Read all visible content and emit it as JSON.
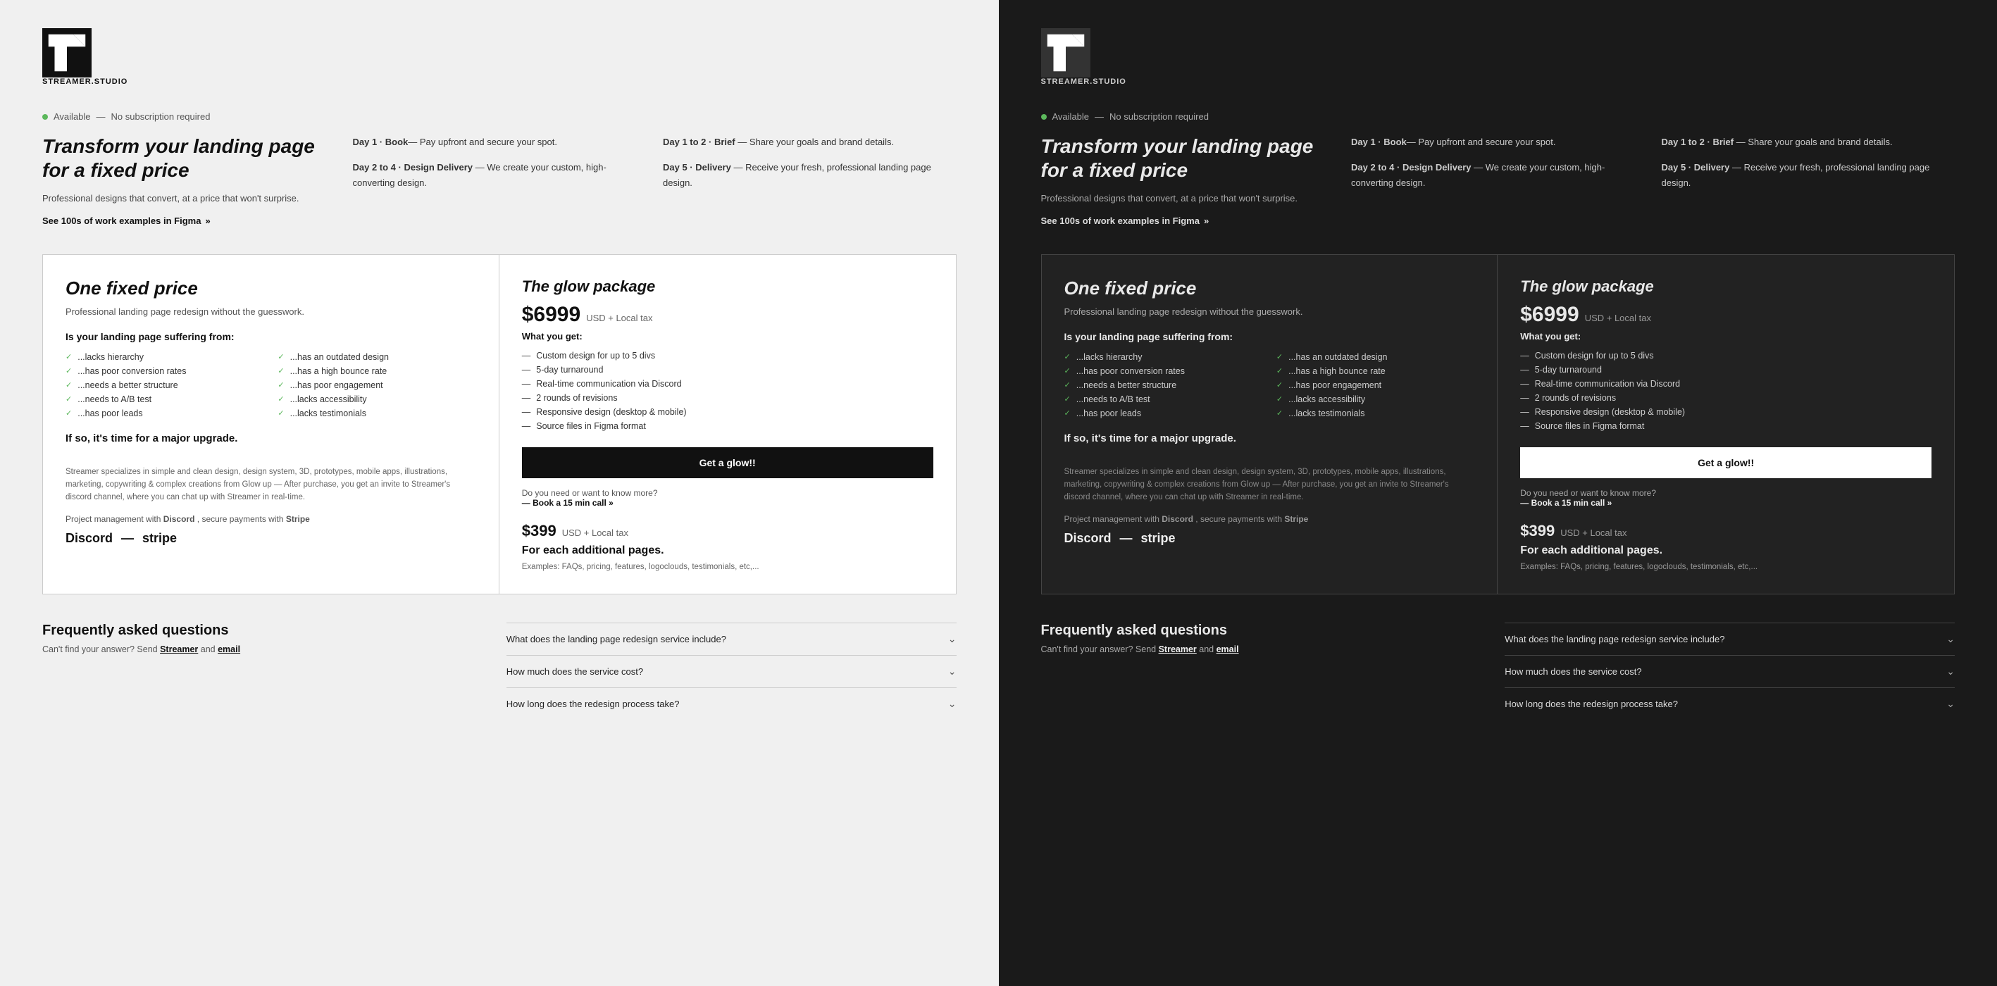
{
  "brand": {
    "name": "STREAMER.STUDIO",
    "available_label": "Available",
    "no_subscription": "No subscription required"
  },
  "hero": {
    "title": "Transform your landing page for a fixed price",
    "subtitle": "Professional designs that convert, at a price that won't surprise.",
    "link_text": "See 100s of work examples in Figma",
    "link_arrow": "»"
  },
  "process": {
    "col1": [
      {
        "bold": "Day 1 · Book",
        "rest": "— Pay upfront and secure your spot."
      },
      {
        "bold": "Day 2 to 4 · Design Delivery",
        "rest": "— We create your custom, high-converting design."
      }
    ],
    "col2": [
      {
        "bold": "Day 1 to 2 · Brief",
        "rest": "— Share your goals and brand details."
      },
      {
        "bold": "Day 5 · Delivery",
        "rest": "— Receive your fresh, professional landing page design."
      }
    ]
  },
  "pricing": {
    "left": {
      "title": "One fixed price",
      "description": "Professional landing page redesign without the guesswork.",
      "suffering_title": "Is your landing page suffering from:",
      "checklist": [
        "...lacks hierarchy",
        "...has poor conversion rates",
        "...needs a better structure",
        "...needs to A/B test",
        "...has poor leads",
        "...has an outdated design",
        "...has a high bounce rate",
        "...has poor engagement",
        "...lacks accessibility",
        "...lacks testimonials"
      ],
      "upgrade_text": "If so, it's time for a major upgrade.",
      "footer_text": "Streamer specializes in simple and clean design, design system, 3D, prototypes, mobile apps, illustrations, marketing, copywriting & complex creations from Glow up — After purchase, you get an invite to Streamer's discord channel, where you can chat up with Streamer in real-time.",
      "pm_text": "Project management with",
      "pm_discord": "Discord",
      "pm_middle": ", secure payments with",
      "pm_stripe": "Stripe",
      "brand_discord": "Discord",
      "brand_dash": "—",
      "brand_stripe": "stripe"
    },
    "right": {
      "title": "The glow package",
      "price": "$6999",
      "price_suffix": "USD + Local tax",
      "what_you_get": "What you get:",
      "features": [
        "Custom design for up to 5 divs",
        "5-day turnaround",
        "Real-time communication via Discord",
        "2 rounds of revisions",
        "Responsive design (desktop & mobile)",
        "Source files in Figma format"
      ],
      "cta_label": "Get a glow!!",
      "know_more_text": "Do you need or want to know more?",
      "book_call": "— Book a 15 min call »",
      "additional_price": "$399",
      "additional_suffix": "USD + Local tax",
      "additional_title": "For each additional pages.",
      "additional_examples": "Examples: FAQs, pricing, features, logoclouds, testimonials, etc,..."
    }
  },
  "faq": {
    "title": "Frequently asked questions",
    "subtitle_pre": "Can't find your answer? Send",
    "streamer_link": "Streamer",
    "subtitle_mid": "and",
    "email_link": "email",
    "questions": [
      "What does the landing page redesign service include?",
      "How much does the service cost?",
      "How long does the redesign process take?"
    ]
  }
}
